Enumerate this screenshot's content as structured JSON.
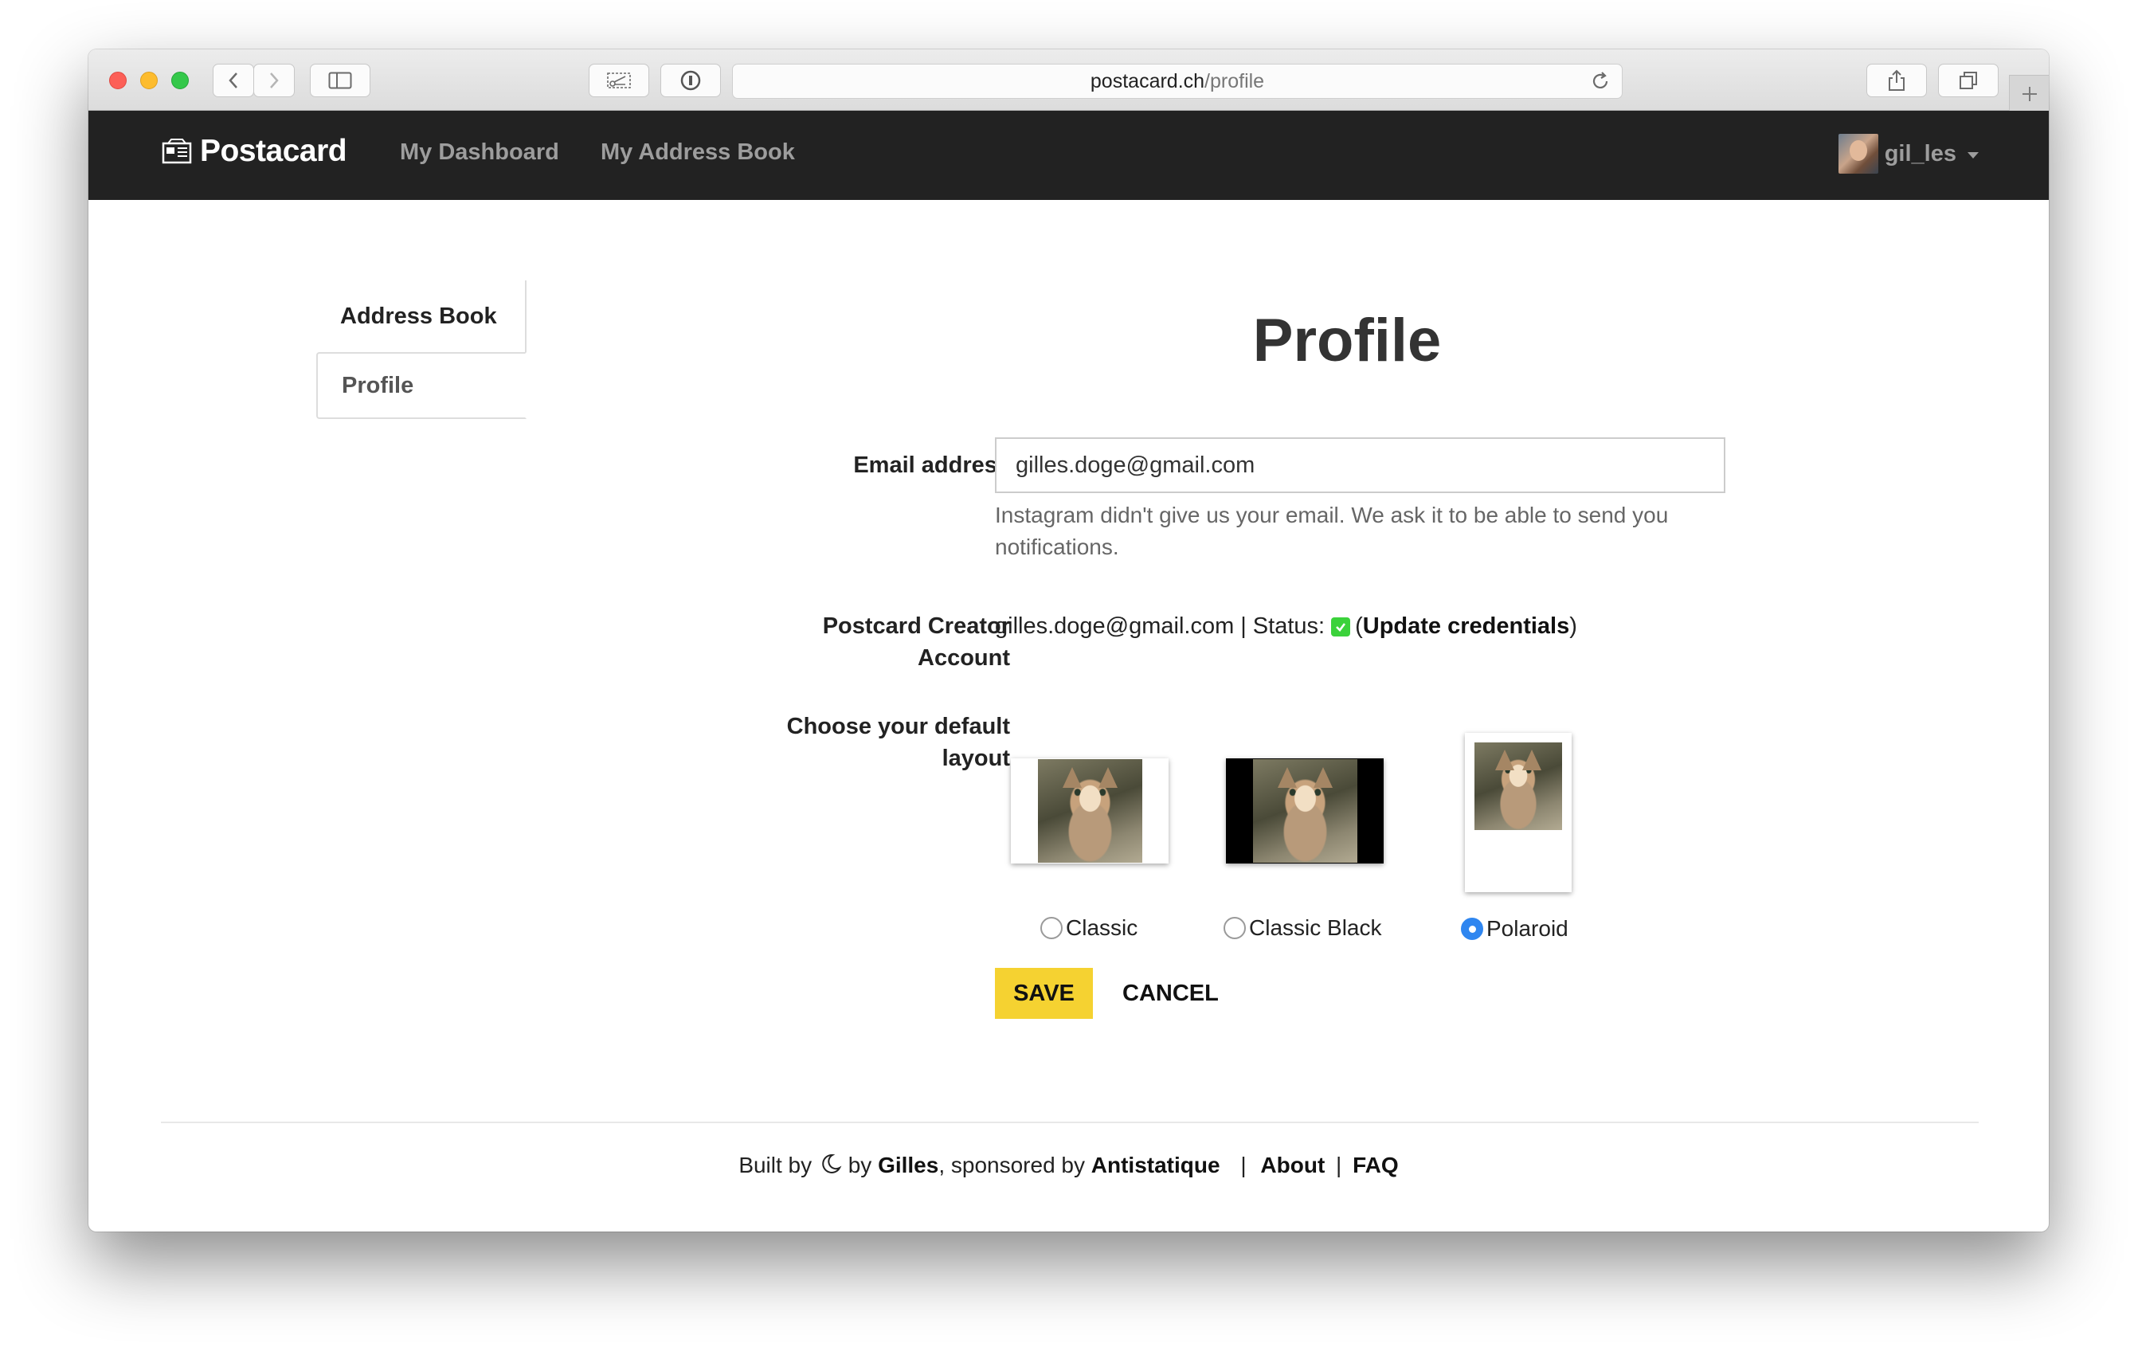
{
  "browser": {
    "url_domain": "postacard.ch",
    "url_path": "/profile"
  },
  "navbar": {
    "brand": "Postacard",
    "links": [
      "My Dashboard",
      "My Address Book"
    ],
    "username": "gil_les"
  },
  "sidebar": {
    "items": [
      {
        "label": "Address Book",
        "active": false
      },
      {
        "label": "Profile",
        "active": true
      }
    ]
  },
  "page": {
    "title": "Profile",
    "email_label": "Email address",
    "email_value": "gilles.doge@gmail.com",
    "email_help": "Instagram didn't give us your email. We ask it to be able to send you notifications.",
    "pc_label_line1": "Postcard Creator",
    "pc_label_line2": "Account",
    "pc_email": "gilles.doge@gmail.com",
    "pc_separator": "|",
    "pc_status_label": "Status:",
    "pc_update_open": "(",
    "pc_update_link": "Update credentials",
    "pc_update_close": ")",
    "layout_label_line1": "Choose your default",
    "layout_label_line2": "layout",
    "layouts": [
      {
        "label": "Classic",
        "selected": false
      },
      {
        "label": "Classic Black",
        "selected": false
      },
      {
        "label": "Polaroid",
        "selected": true
      }
    ],
    "save_label": "SAVE",
    "cancel_label": "CANCEL"
  },
  "footer": {
    "built_by": "Built by",
    "by": "by",
    "author": "Gilles",
    "sponsored_by": ", sponsored by",
    "sponsor": "Antistatique",
    "sep": "|",
    "about": "About",
    "faq": "FAQ"
  },
  "colors": {
    "navbar_bg": "#222222",
    "save_button": "#f5d231",
    "status_ok": "#3bd23b",
    "radio_selected": "#2f86f0"
  }
}
